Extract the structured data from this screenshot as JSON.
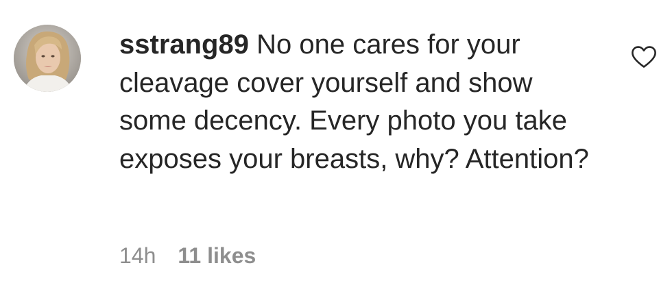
{
  "comment": {
    "username": "sstrang89",
    "text": "No one cares for your cleavage cover yourself and show some decency. Every photo you take exposes your breasts, why? Attention?",
    "time": "14h",
    "likes": "11 likes",
    "avatar_icon": "user-avatar-photo",
    "like_icon": "heart-outline-icon"
  },
  "colors": {
    "text": "#262626",
    "meta": "#8e8e8e",
    "background": "#ffffff"
  }
}
